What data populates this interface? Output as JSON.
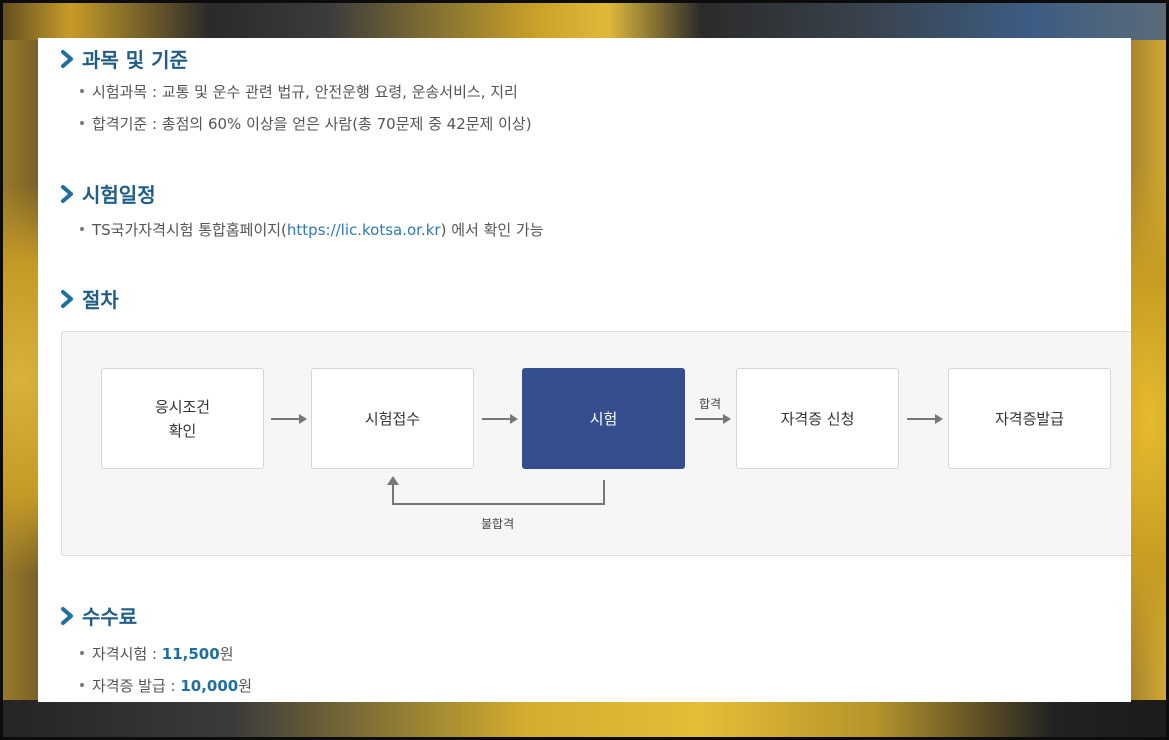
{
  "sections": {
    "subjects": {
      "title": "과목 및 기준",
      "items": [
        "시험과목 : 교통 및 운수 관련 법규, 안전운행 요령, 운송서비스, 지리",
        "합격기준 : 총점의 60% 이상을 얻은 사람(총 70문제 중 42문제 이상)"
      ]
    },
    "schedule": {
      "title": "시험일정",
      "prefix": "TS국가자격시험 통합홈페이지(",
      "link": "https://lic.kotsa.or.kr",
      "suffix": ") 에서 확인 가능"
    },
    "procedure": {
      "title": "절차",
      "steps": [
        "응시조건\n확인",
        "시험접수",
        "시험",
        "자격증 신청",
        "자격증발급"
      ],
      "pass_label": "합격",
      "fail_label": "불합격"
    },
    "fees": {
      "title": "수수료",
      "items": [
        {
          "label": "자격시험 : ",
          "value": "11,500",
          "unit": "원"
        },
        {
          "label": "자격증 발급 : ",
          "value": "10,000",
          "unit": "원"
        }
      ]
    }
  },
  "colors": {
    "title": "#1f5d86",
    "active_step": "#354f8e",
    "link": "#2f7ab0"
  },
  "icons": {
    "section_marker": "chevron-right-icon"
  }
}
